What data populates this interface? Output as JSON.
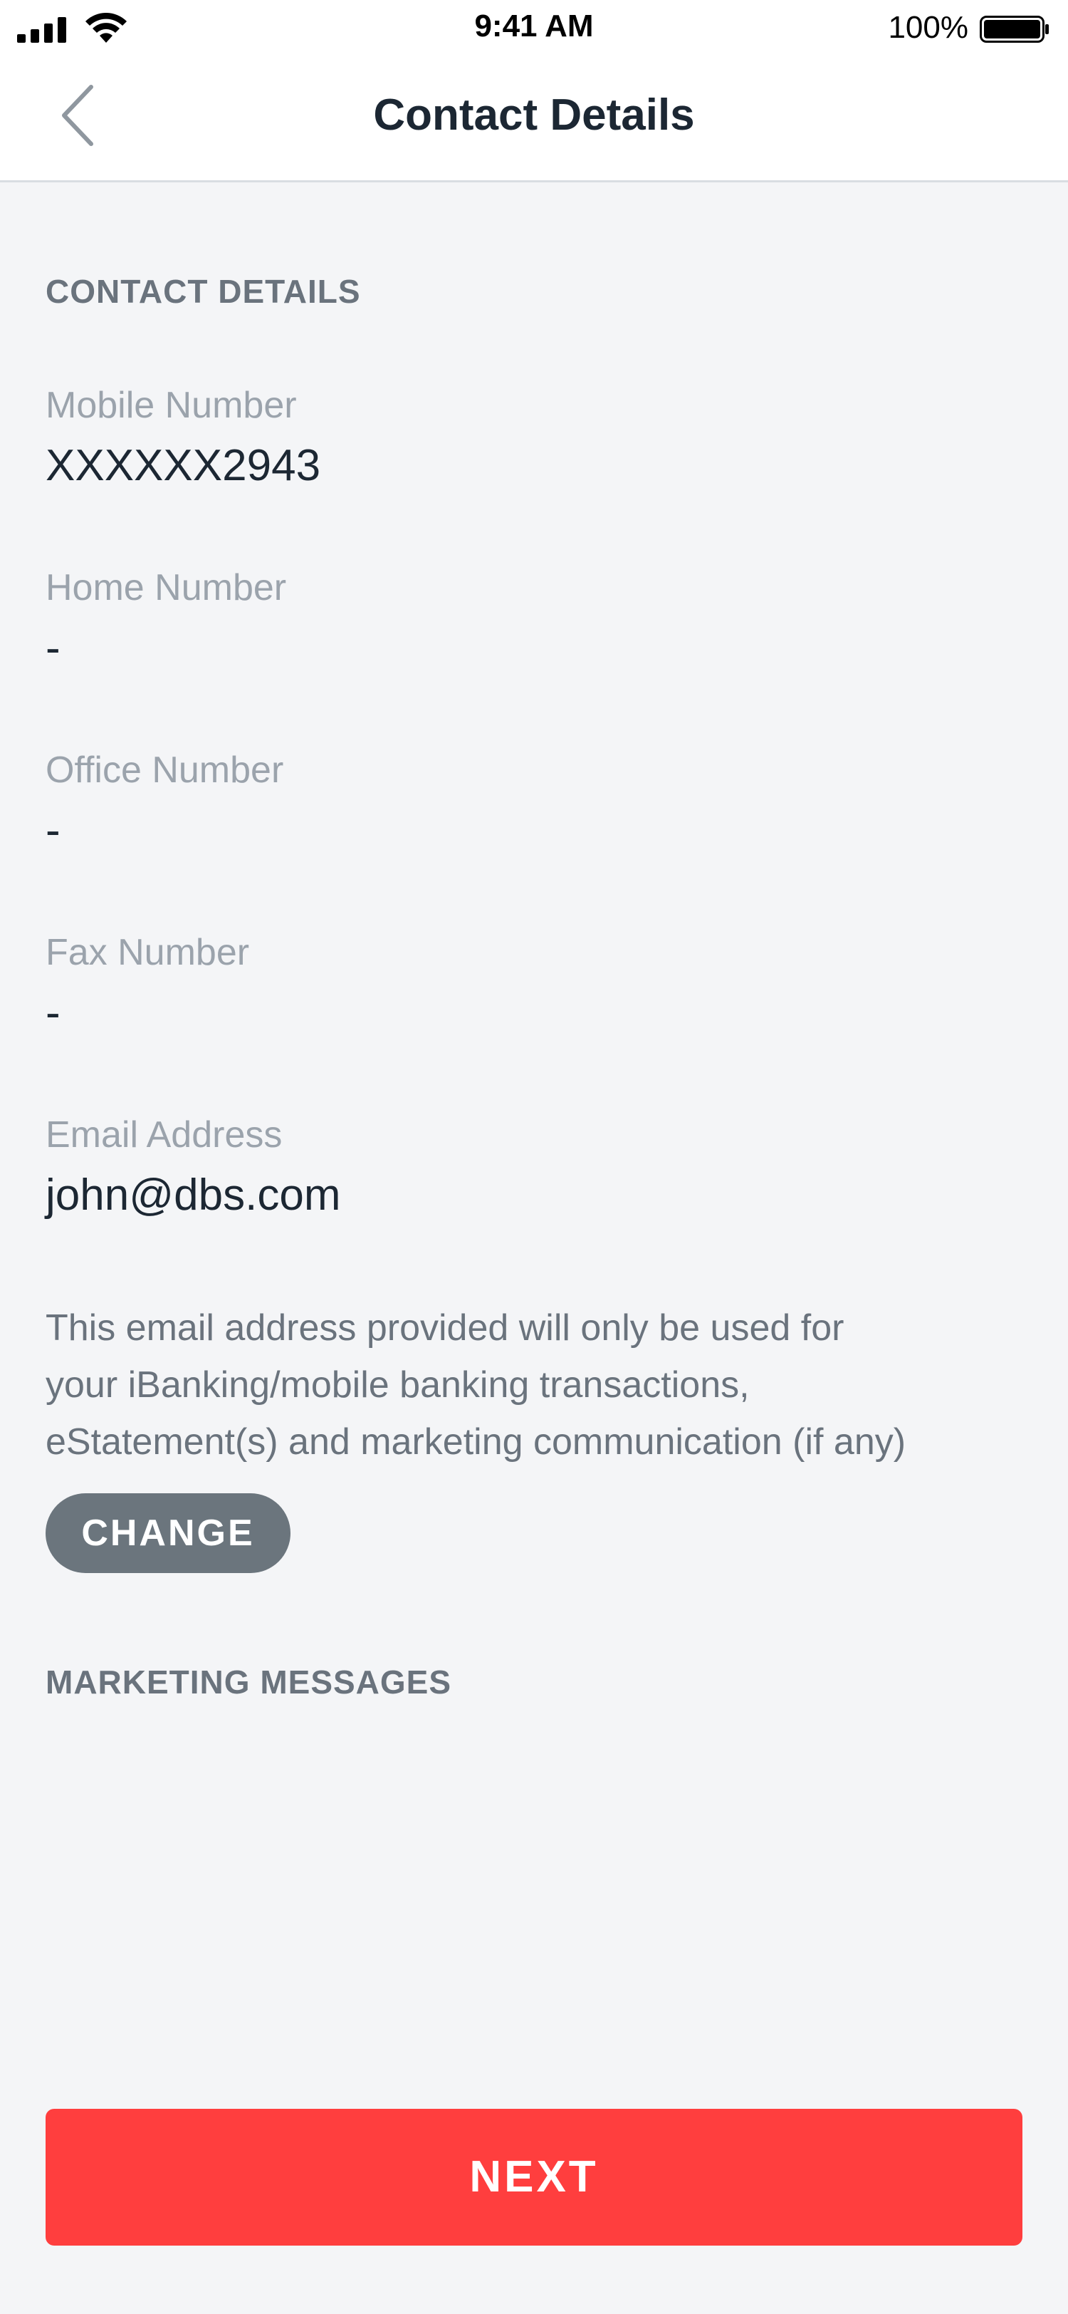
{
  "status_bar": {
    "time": "9:41 AM",
    "battery_percent": "100%",
    "battery_level": 1.0,
    "icons": [
      "cellular-signal-icon",
      "wifi-icon",
      "battery-icon"
    ]
  },
  "header": {
    "title": "Contact Details",
    "back_icon": "chevron-left-icon"
  },
  "sections": {
    "contact_details_header": "CONTACT DETAILS",
    "marketing_messages_header": "MARKETING MESSAGES"
  },
  "fields": {
    "mobile": {
      "label": "Mobile Number",
      "value": "XXXXXX2943"
    },
    "home": {
      "label": "Home Number",
      "value": "-"
    },
    "office": {
      "label": "Office Number",
      "value": "-"
    },
    "fax": {
      "label": "Fax Number",
      "value": "-"
    },
    "email": {
      "label": "Email Address",
      "value": "john@dbs.com"
    }
  },
  "disclaimer": {
    "line1": "This email address provided will only be used for",
    "line2": "your iBanking/mobile banking transactions,",
    "line3": "eStatement(s) and marketing communication (if any)"
  },
  "buttons": {
    "change_label": "CHANGE",
    "next_label": "NEXT"
  },
  "colors": {
    "accent_red": "#ff3e3e",
    "secondary_button": "#6b757d",
    "background": "#f4f5f7"
  }
}
